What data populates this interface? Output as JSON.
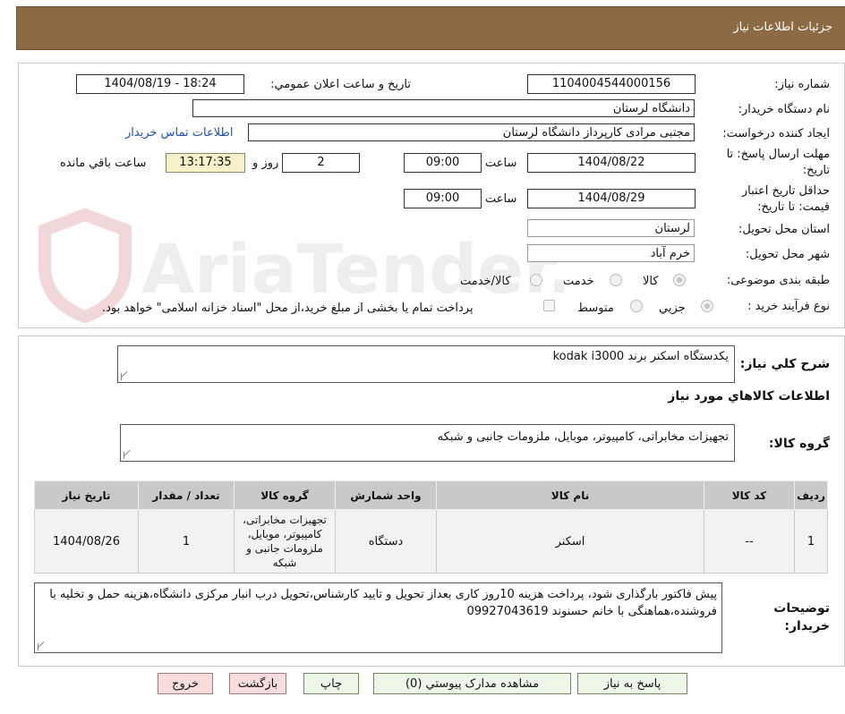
{
  "header": {
    "title": "جزئيات اطلاعات نياز"
  },
  "watermark": {
    "text": "AriaTender.neT"
  },
  "form": {
    "need_number_label": "شماره نياز:",
    "need_number": "1104004544000156",
    "announce_label": "تاريخ و ساعت اعلان عمومي:",
    "announce_value": "1404/08/19 - 18:24",
    "buyer_org_label": "نام دستگاه خريدار:",
    "buyer_org": "دانشگاه لرستان",
    "creator_label": "ايجاد کننده درخواست:",
    "creator": "مجتبی مرادی کارپرداز دانشگاه لرستان",
    "contact_link": "اطلاعات تماس خريدار",
    "deadline_label_1": "مهلت ارسال پاسخ: تا",
    "deadline_label_2": "تاريخ:",
    "deadline_date": "1404/08/22",
    "time_label": "ساعت",
    "deadline_time": "09:00",
    "days_value": "2",
    "days_label": "روز و",
    "remaining_time": "13:17:35",
    "remaining_label": "ساعت باقي مانده",
    "validity_label_1": "حداقل تاريخ اعتبار",
    "validity_label_2": "قيمت: تا تاريخ:",
    "validity_date": "1404/08/29",
    "validity_time": "09:00",
    "province_label": "استان محل تحويل:",
    "province": "لرستان",
    "city_label": "شهر محل تحويل:",
    "city": "خرم آباد",
    "category_label": "طبقه بندی موضوعی:",
    "category_options": [
      "کالا",
      "خدمت",
      "کالا/خدمت"
    ],
    "category_selected": "کالا",
    "process_label": "نوع فرآيند خريد :",
    "process_options": [
      "جزيي",
      "متوسط"
    ],
    "process_selected": "جزيي",
    "payment_note": "پرداخت تمام يا بخشی از مبلغ خريد،از محل \"اسناد خزانه اسلامی\" خواهد بود."
  },
  "details": {
    "description_label": "شرح کلي نياز:",
    "description": "يکدستگاه اسکنر برند kodak i3000",
    "goods_info_title": "اطلاعات کالاهاي مورد نياز",
    "goods_group_label": "گروه کالا:",
    "goods_group": "تجهيزات مخابراتی، کامپيوتر، موبايل، ملزومات جانبی و شبکه"
  },
  "table": {
    "headers": [
      "رديف",
      "کد کالا",
      "نام کالا",
      "واحد شمارش",
      "گروه کالا",
      "تعداد / مقدار",
      "تاريخ نياز"
    ],
    "rows": [
      {
        "row": "1",
        "code": "--",
        "name": "اسکنر",
        "unit": "دستگاه",
        "group": "تجهيزات مخابراتی، کامپيوتر، موبايل، ملزومات جانبی و شبکه",
        "qty": "1",
        "date": "1404/08/26"
      }
    ]
  },
  "buyer_notes": {
    "label_1": "توضيحات",
    "label_2": "خريدار:",
    "text": "پيش فاکتور بارگذاری شود، پرداخت هزينه 10روز کاری بعداز تحويل و تاييد کارشناس،تحويل درب انبار مرکزی دانشگاه،هزينه حمل و تخليه با فروشنده،هماهنگی با خانم حسنوند 09927043619"
  },
  "buttons": {
    "reply": "پاسخ به نياز",
    "attachments": "مشاهده مدارک پيوستي (0)",
    "print": "چاپ",
    "back": "بازگشت",
    "exit": "خروج"
  }
}
